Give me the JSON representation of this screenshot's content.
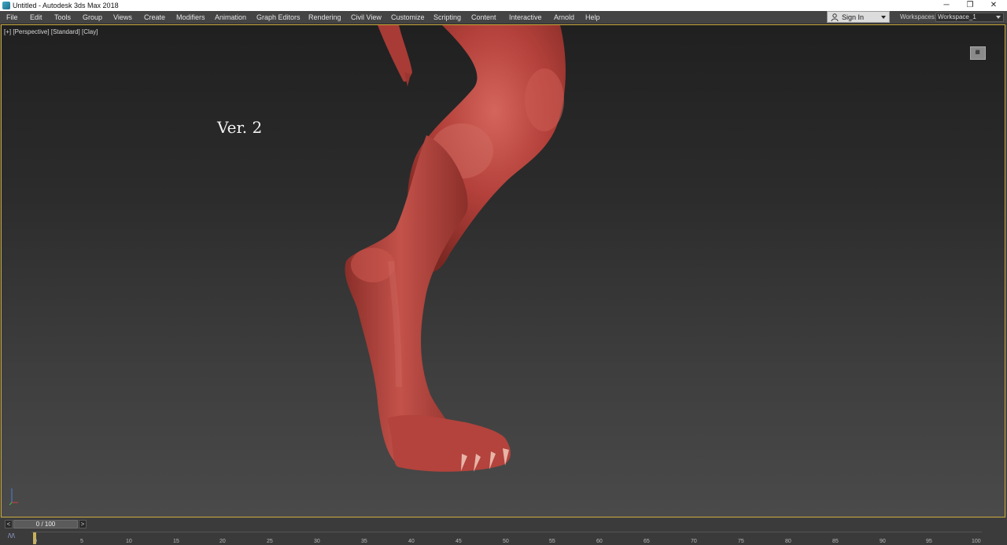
{
  "window": {
    "title": "Untitled - Autodesk 3ds Max 2018",
    "minimize": "─",
    "maximize": "❐",
    "close": "✕"
  },
  "menu": [
    "File",
    "Edit",
    "Tools",
    "Group",
    "Views",
    "Create",
    "Modifiers",
    "Animation",
    "Graph Editors",
    "Rendering",
    "Civil View",
    "Customize",
    "Scripting",
    "Content",
    "Interactive",
    "Arnold",
    "Help"
  ],
  "account": {
    "sign_in": "Sign In"
  },
  "workspace": {
    "label": "Workspaces:",
    "value": "Workspace_1"
  },
  "viewport": {
    "labels": {
      "plus": "[+]",
      "view": "[Perspective]",
      "shading_std": "[Standard]",
      "shading": "[Clay]"
    },
    "annotation": "Ver. 2",
    "model_color": "#b3403a"
  },
  "timeline": {
    "frame_display": "0 / 100",
    "prev": "<",
    "next": ">",
    "ticks": [
      "0",
      "5",
      "10",
      "15",
      "20",
      "25",
      "30",
      "35",
      "40",
      "45",
      "50",
      "55",
      "60",
      "65",
      "70",
      "75",
      "80",
      "85",
      "90",
      "95",
      "100"
    ]
  },
  "colors": {
    "viewport_border": "#c9a93a",
    "menubar": "#444444"
  }
}
